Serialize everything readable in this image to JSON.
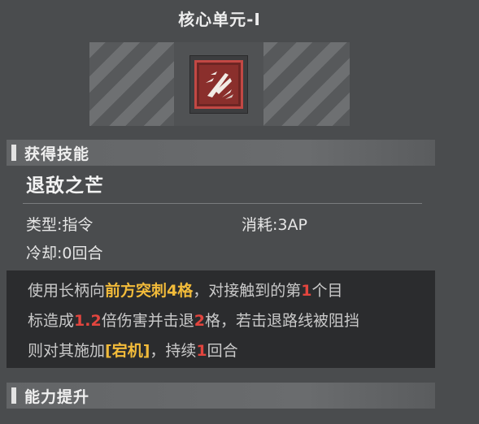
{
  "title": "核心单元-Ⅰ",
  "acquired_section": {
    "label": "获得技能"
  },
  "skill": {
    "icon": "blade-slash-icon",
    "name": "退敌之芒",
    "type_label": "类型:",
    "type_value": "指令",
    "cost_label": "消耗:",
    "cost_value": "3AP",
    "cooldown_label": "冷却:",
    "cooldown_value": "0回合",
    "description": {
      "line1": {
        "t1": "使用长柄向",
        "h1": "前方突刺4格",
        "t2": "，对接触到的第",
        "n1": "1",
        "t3": "个目"
      },
      "line2": {
        "t1": "标造成",
        "n1": "1.2",
        "t2": "倍伤害并击退",
        "n2": "2",
        "t3": "格，若击退路线被阻挡"
      },
      "line3": {
        "t1": "则对其施加",
        "h1": "[宕机]",
        "t2": "，持续",
        "n1": "1",
        "t3": "回合"
      }
    }
  },
  "upgrade_section": {
    "label": "能力提升"
  },
  "colors": {
    "highlight_yellow": "#f2bb3a",
    "highlight_red": "#e2453e",
    "frame_red": "#c24844"
  }
}
